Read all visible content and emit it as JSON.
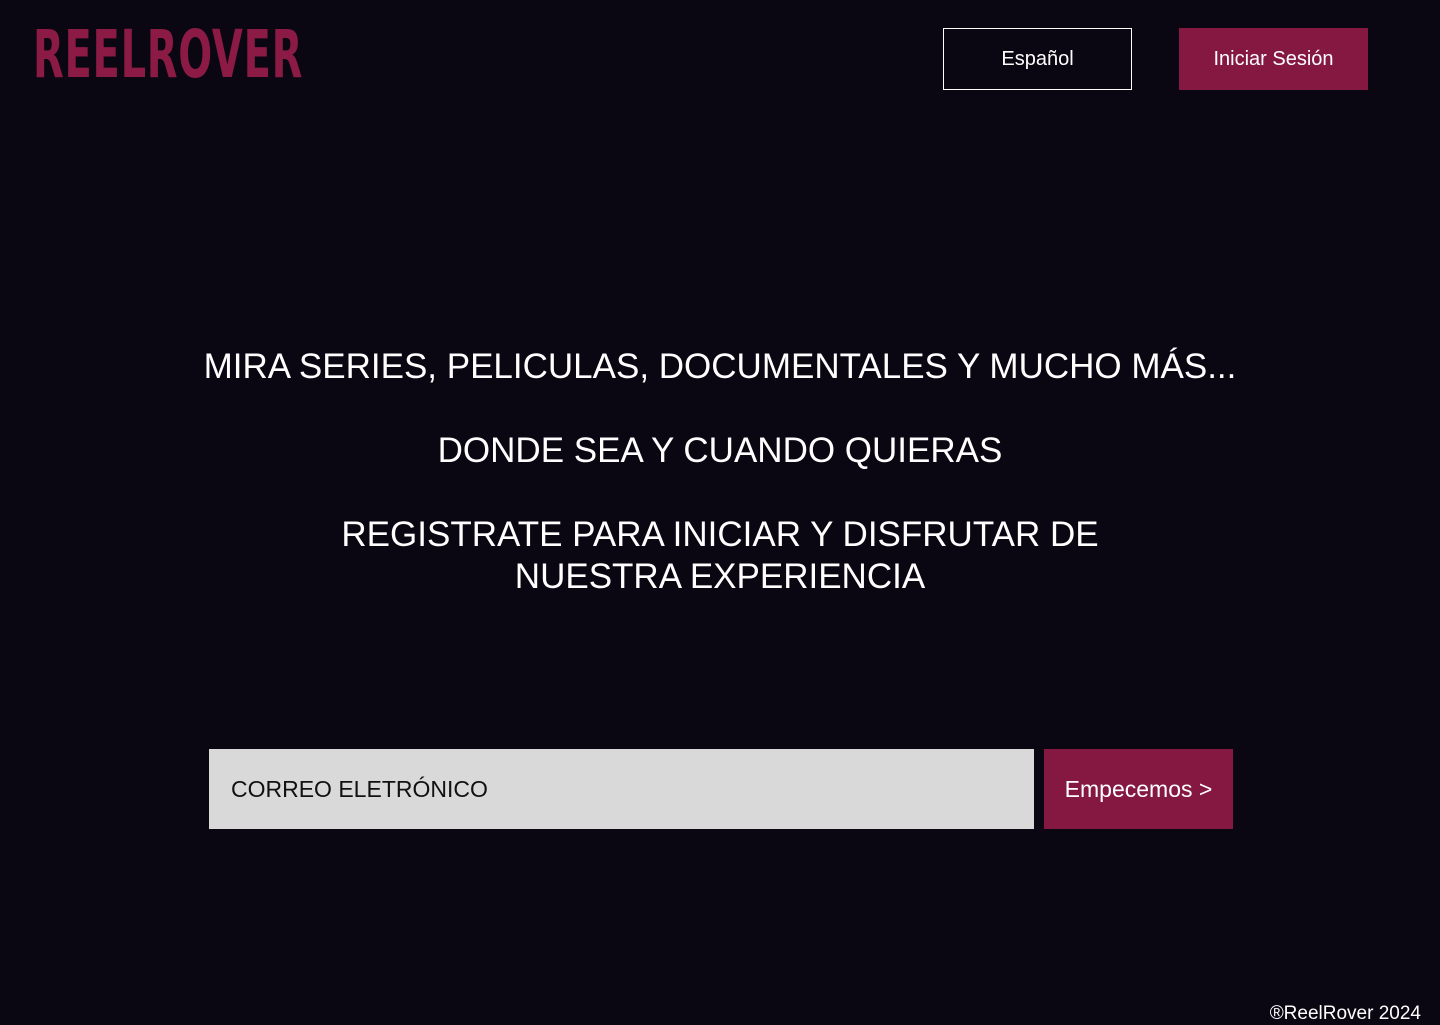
{
  "brand": {
    "logo_text": "REELROVER",
    "accent_color": "#841840",
    "background_color": "#0a0612"
  },
  "header": {
    "language_label": "Español",
    "login_label": "Iniciar Sesión"
  },
  "hero": {
    "line1": "MIRA SERIES, PELICULAS, DOCUMENTALES Y MUCHO MÁS...",
    "line2": "DONDE SEA Y CUANDO QUIERAS",
    "line3": "REGISTRATE PARA INICIAR Y DISFRUTAR DE NUESTRA EXPERIENCIA"
  },
  "signup": {
    "email_placeholder": "CORREO ELETRÓNICO",
    "email_value": "",
    "start_label": "Empecemos >"
  },
  "footer": {
    "copyright": "®ReelRover 2024"
  }
}
